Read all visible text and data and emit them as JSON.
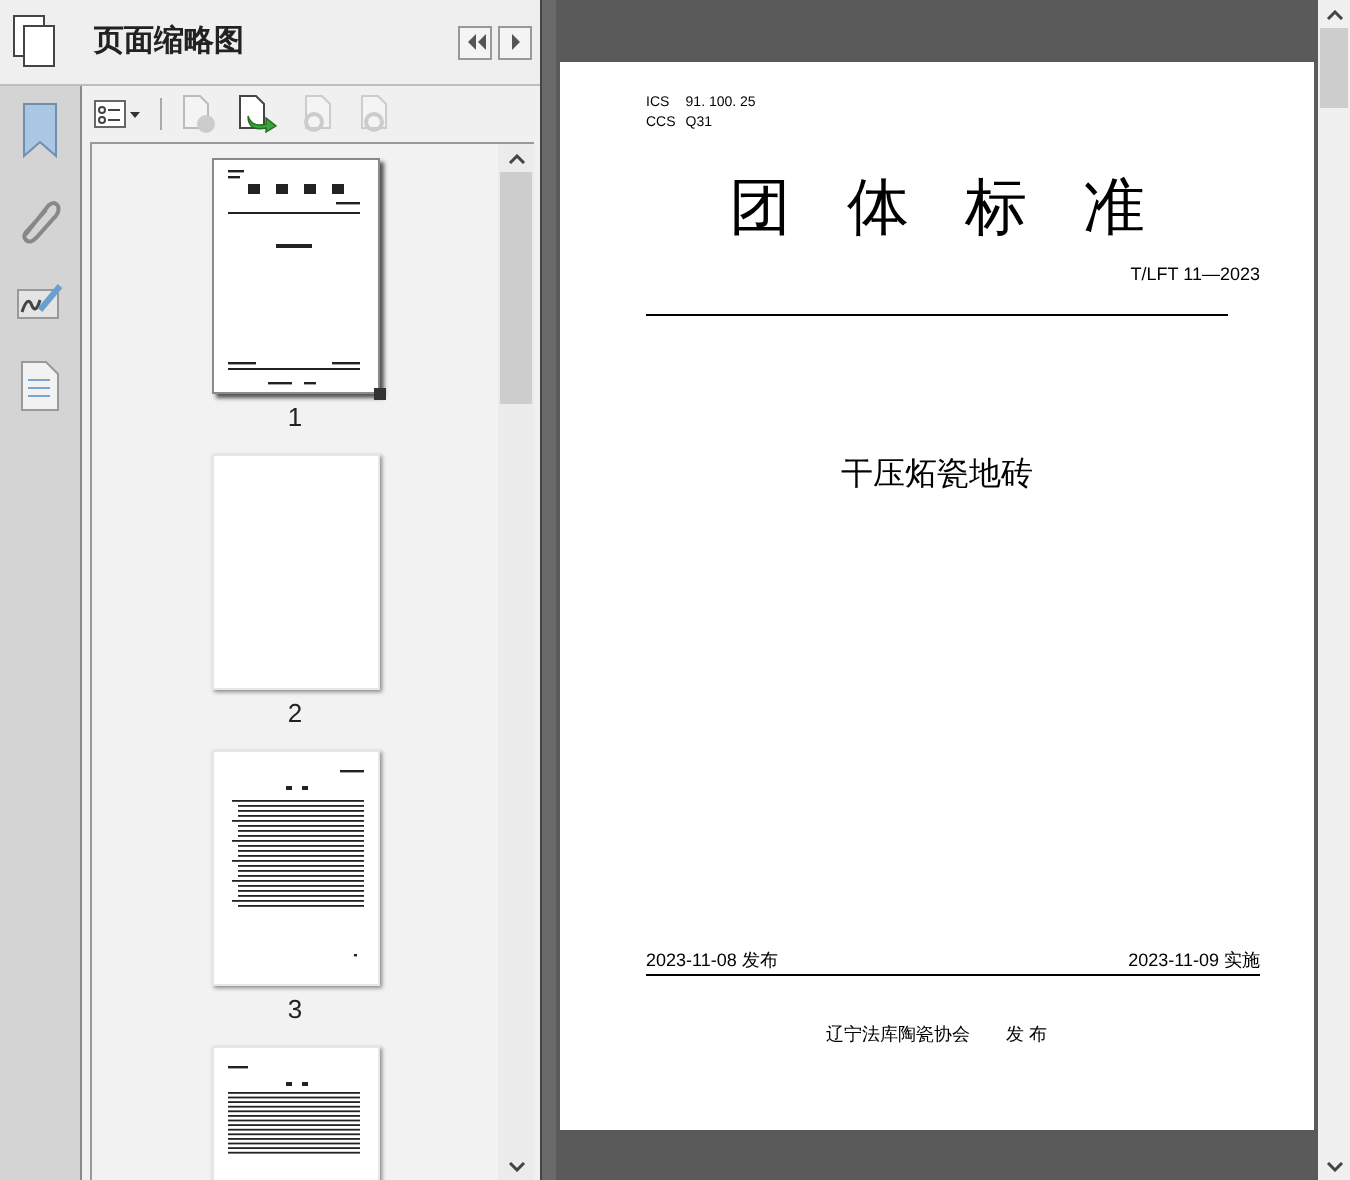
{
  "panel": {
    "title": "页面缩略图"
  },
  "thumbnails": [
    {
      "kind": "cover",
      "label": "1",
      "selected": true
    },
    {
      "kind": "blank",
      "label": "2",
      "selected": false
    },
    {
      "kind": "contents",
      "label": "3",
      "selected": false
    },
    {
      "kind": "text",
      "selected": false
    }
  ],
  "document": {
    "ics_label": "ICS",
    "ics_code": "91. 100. 25",
    "ccs_label": "CCS",
    "ccs_code": "Q31",
    "title_chars": [
      "团",
      "体",
      "标",
      "准"
    ],
    "standard_number": "T/LFT 11—2023",
    "product_name": "干压炻瓷地砖",
    "issue_date": "2023-11-08 发布",
    "implement_date": "2023-11-09 实施",
    "publisher": "辽宁法库陶瓷协会",
    "publish_word": "发 布"
  }
}
